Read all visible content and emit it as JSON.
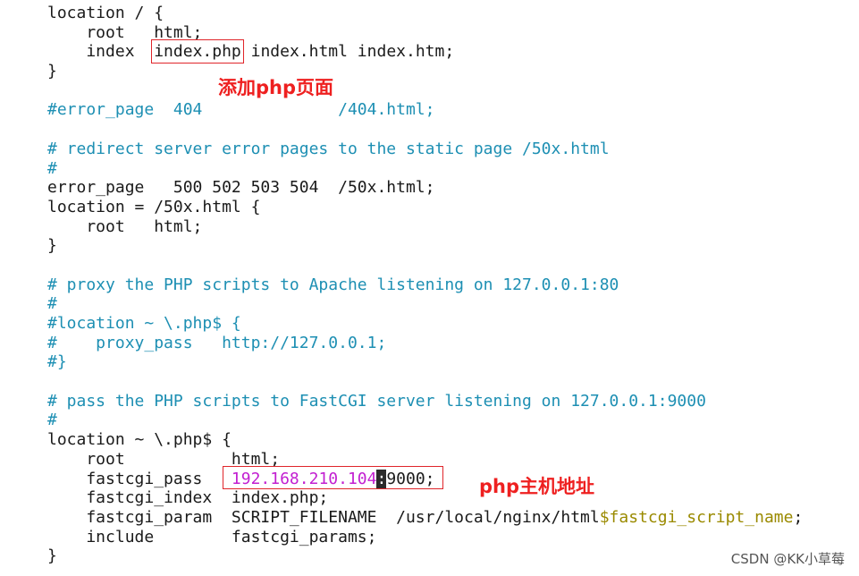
{
  "code_lines": [
    {
      "kind": "plain",
      "text": "location / {"
    },
    {
      "kind": "plain",
      "text": "    root   html;"
    },
    {
      "kind": "index",
      "pre": "    index  ",
      "boxed": "index.php",
      "post": " index.html index.htm;"
    },
    {
      "kind": "plain",
      "text": "}"
    },
    {
      "kind": "plain",
      "text": ""
    },
    {
      "kind": "comment",
      "text": "#error_page  404              /404.html;"
    },
    {
      "kind": "plain",
      "text": ""
    },
    {
      "kind": "comment",
      "text": "# redirect server error pages to the static page /50x.html"
    },
    {
      "kind": "comment",
      "text": "#"
    },
    {
      "kind": "plain",
      "text": "error_page   500 502 503 504  /50x.html;"
    },
    {
      "kind": "plain",
      "text": "location = /50x.html {"
    },
    {
      "kind": "plain",
      "text": "    root   html;"
    },
    {
      "kind": "plain",
      "text": "}"
    },
    {
      "kind": "plain",
      "text": ""
    },
    {
      "kind": "comment",
      "text": "# proxy the PHP scripts to Apache listening on 127.0.0.1:80"
    },
    {
      "kind": "comment",
      "text": "#"
    },
    {
      "kind": "comment",
      "text": "#location ~ \\.php$ {"
    },
    {
      "kind": "comment",
      "text": "#    proxy_pass   http://127.0.0.1;"
    },
    {
      "kind": "comment",
      "text": "#}"
    },
    {
      "kind": "plain",
      "text": ""
    },
    {
      "kind": "comment",
      "text": "# pass the PHP scripts to FastCGI server listening on 127.0.0.1:9000"
    },
    {
      "kind": "comment",
      "text": "#"
    },
    {
      "kind": "plain",
      "text": "location ~ \\.php$ {"
    },
    {
      "kind": "plain",
      "text": "    root           html;"
    },
    {
      "kind": "fcgi",
      "pre": "    fastcgi_pass   ",
      "ip": "192.168.210.104",
      "cursor": ":",
      "post": "9000;"
    },
    {
      "kind": "plain",
      "text": "    fastcgi_index  index.php;"
    },
    {
      "kind": "param",
      "pre": "    fastcgi_param  SCRIPT_FILENAME  /usr/local/nginx/html",
      "var": "$fastcgi_script_name",
      "post": ";"
    },
    {
      "kind": "plain",
      "text": "    include        fastcgi_params;"
    },
    {
      "kind": "plain",
      "text": "}"
    }
  ],
  "annotations": {
    "add_php_page": "添加php页面",
    "php_host_address": "php主机地址"
  },
  "watermark": "CSDN @KK小草莓",
  "colors": {
    "comment": "#1d8fb3",
    "ip": "#c21fd1",
    "variable": "#9a8a00",
    "annotation": "#ee2020",
    "box": "#e0252a"
  }
}
